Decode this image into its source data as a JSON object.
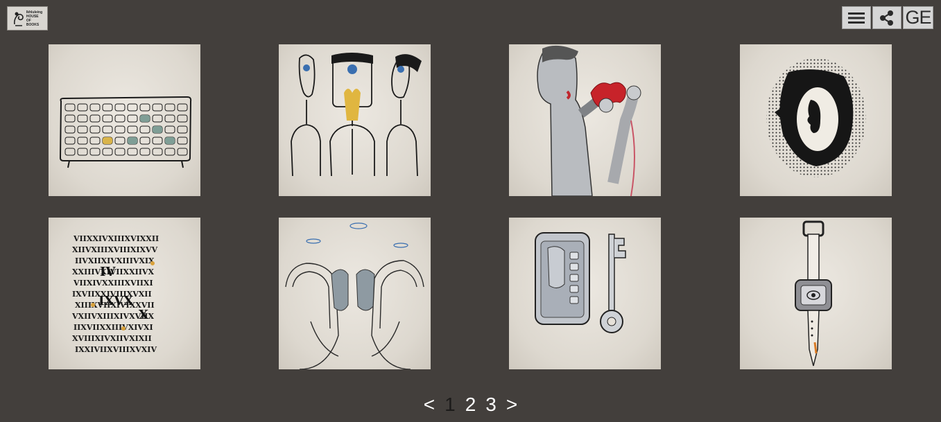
{
  "header": {
    "logo_lines": [
      "Ikhluleing",
      "HOUSE",
      "OF",
      "BOOKS"
    ],
    "menu_icon": "hamburger-menu-icon",
    "share_icon": "share-icon",
    "language_label": "GE"
  },
  "gallery": {
    "items": [
      {
        "subject": "radio-with-eye-buttons"
      },
      {
        "subject": "three-figures-with-eye"
      },
      {
        "subject": "man-with-game-controller"
      },
      {
        "subject": "head-silhouette-in-dots"
      },
      {
        "subject": "roman-numerals-text"
      },
      {
        "subject": "hands-holding-faces"
      },
      {
        "subject": "phone-and-key"
      },
      {
        "subject": "watch-on-knife"
      }
    ]
  },
  "pagination": {
    "prev_label": "<",
    "pages": [
      "1",
      "2",
      "3"
    ],
    "current_page": "1",
    "next_label": ">"
  }
}
